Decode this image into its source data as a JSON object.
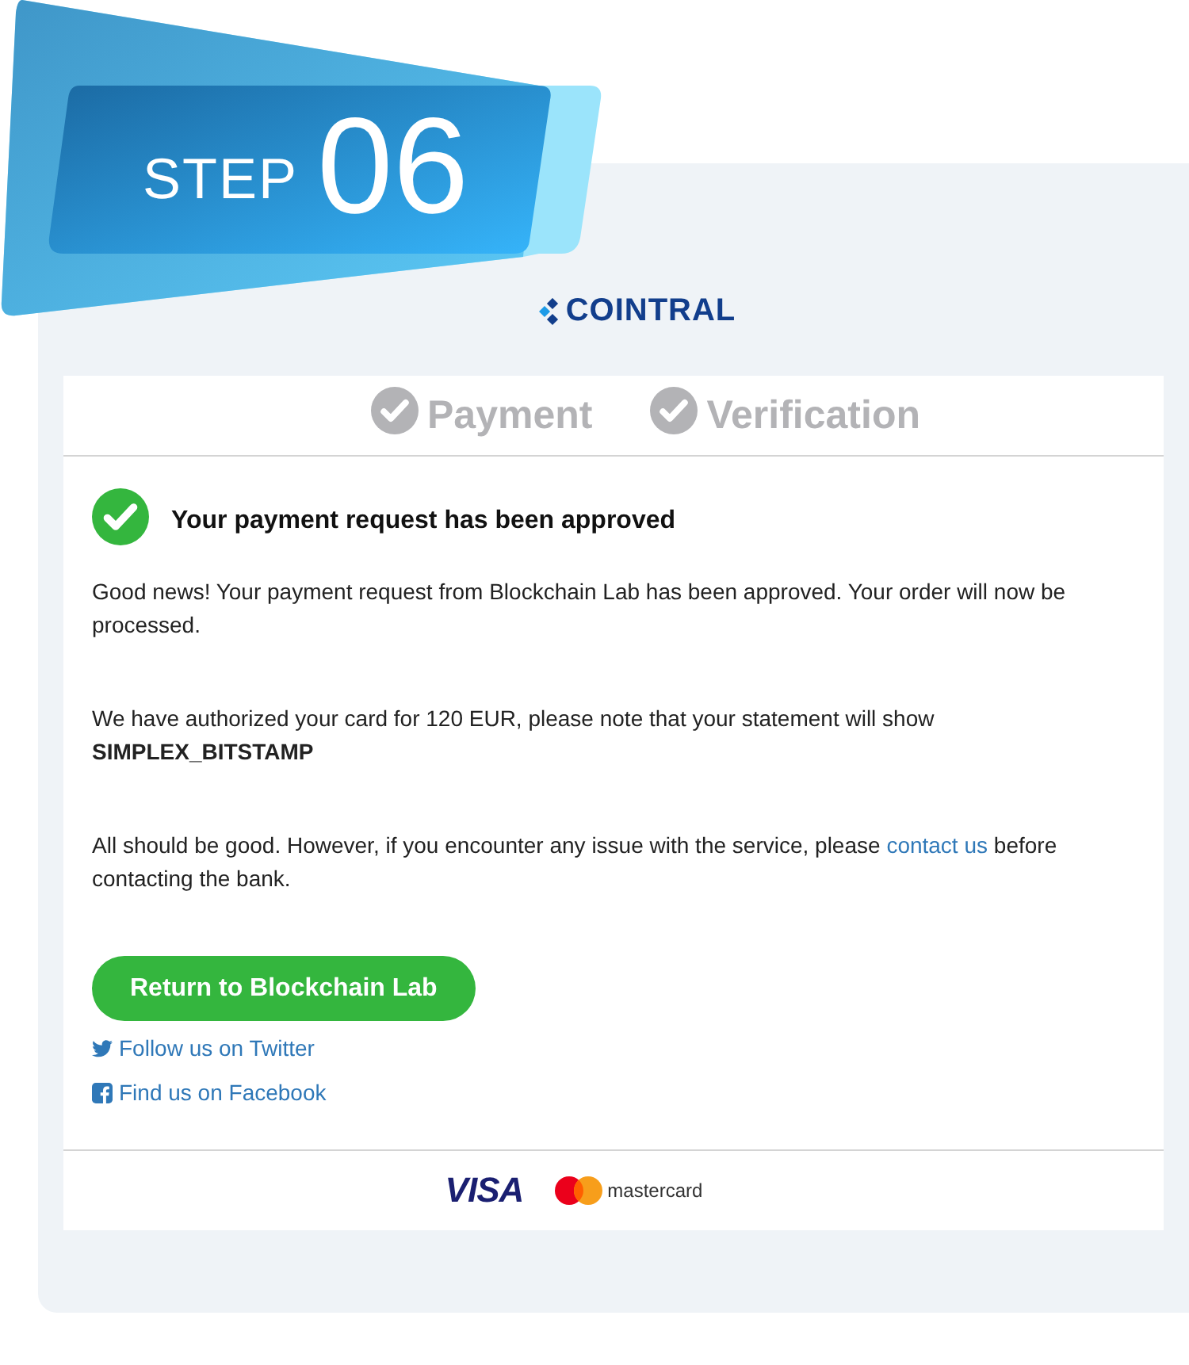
{
  "badge": {
    "label": "STEP",
    "number": "06"
  },
  "brand": {
    "name": "COINTRAL"
  },
  "steps": [
    {
      "label": "Payment",
      "completed": true
    },
    {
      "label": "Verification",
      "completed": true
    }
  ],
  "message": {
    "approved": true,
    "title": "Your payment request has been approved",
    "paragraphs": [
      {
        "text": "Good news! Your payment request from Blockchain Lab has been approved. Your order will now be processed."
      },
      {
        "text": "We have authorized your card for 120 EUR, please note that your statement will show **SIMPLEX_BITSTAMP**"
      },
      {
        "text": "All should be good. However, if you encounter any issue with the service, please",
        "link": "contact us",
        "text_after": "before contacting the bank."
      }
    ]
  },
  "return_button": "Return to Blockchain Lab",
  "social_links": [
    {
      "kind": "twitter",
      "label": "Follow us on Twitter"
    },
    {
      "kind": "facebook",
      "label": "Find us on Facebook"
    }
  ],
  "card_brands": [
    {
      "kind": "visa",
      "label": "VISA"
    },
    {
      "kind": "mastercard",
      "label": "mastercard"
    }
  ]
}
